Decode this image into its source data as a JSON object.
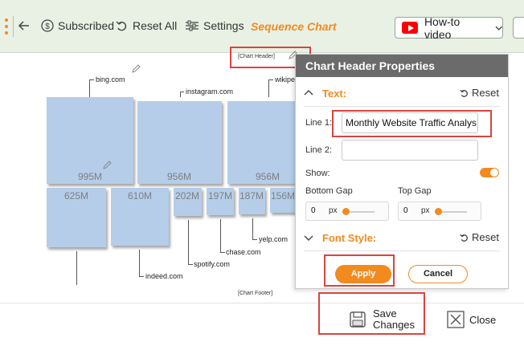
{
  "toolbar": {
    "subscribed_label": "Subscribed",
    "reset_all_label": "Reset All",
    "settings_label": "Settings",
    "app_title": "Sequence Chart",
    "howto_label": "How-to video"
  },
  "chart": {
    "header_placeholder": "[Chart Header]",
    "footer_placeholder": "[Chart Footer]",
    "tiles": [
      {
        "name": "bing.com",
        "value": "995M"
      },
      {
        "name": "instagram.com",
        "value": "956M"
      },
      {
        "name": "wikipedia",
        "value": "956M"
      },
      {
        "name": "indeed.com",
        "value": "625M"
      },
      {
        "name": "",
        "value": "610M"
      },
      {
        "name": "spotify.com",
        "value": "202M"
      },
      {
        "name": "chase.com",
        "value": "197M"
      },
      {
        "name": "yelp.com",
        "value": "187M"
      },
      {
        "name": "",
        "value": "156M"
      }
    ],
    "labels": {
      "bing": "bing.com",
      "instagram": "instagram.com",
      "wikipedia": "wikipe",
      "indeed": "indeed.com",
      "spotify": "spotify.com",
      "chase": "chase.com",
      "yelp": "yelp.com"
    }
  },
  "panel": {
    "title": "Chart Header Properties",
    "text_section": "Text:",
    "reset_label": "Reset",
    "line1_label": "Line 1:",
    "line1_value": "Monthly Website Traffic Analys",
    "line2_label": "Line 2:",
    "line2_value": "",
    "show_label": "Show:",
    "bottom_gap_label": "Bottom Gap",
    "top_gap_label": "Top Gap",
    "bottom_gap_value": "0",
    "top_gap_value": "0",
    "unit": "px",
    "font_section": "Font Style:",
    "font_reset_label": "Reset",
    "apply_label": "Apply",
    "cancel_label": "Cancel"
  },
  "footer": {
    "save_line1": "Save",
    "save_line2": "Changes",
    "close_label": "Close"
  },
  "colors": {
    "accent": "#f28a1e",
    "tile": "#b5cde9",
    "highlight": "#d9443f",
    "toolbar_bg": "#e8f1e4",
    "panel_header": "#6b6b6b"
  }
}
